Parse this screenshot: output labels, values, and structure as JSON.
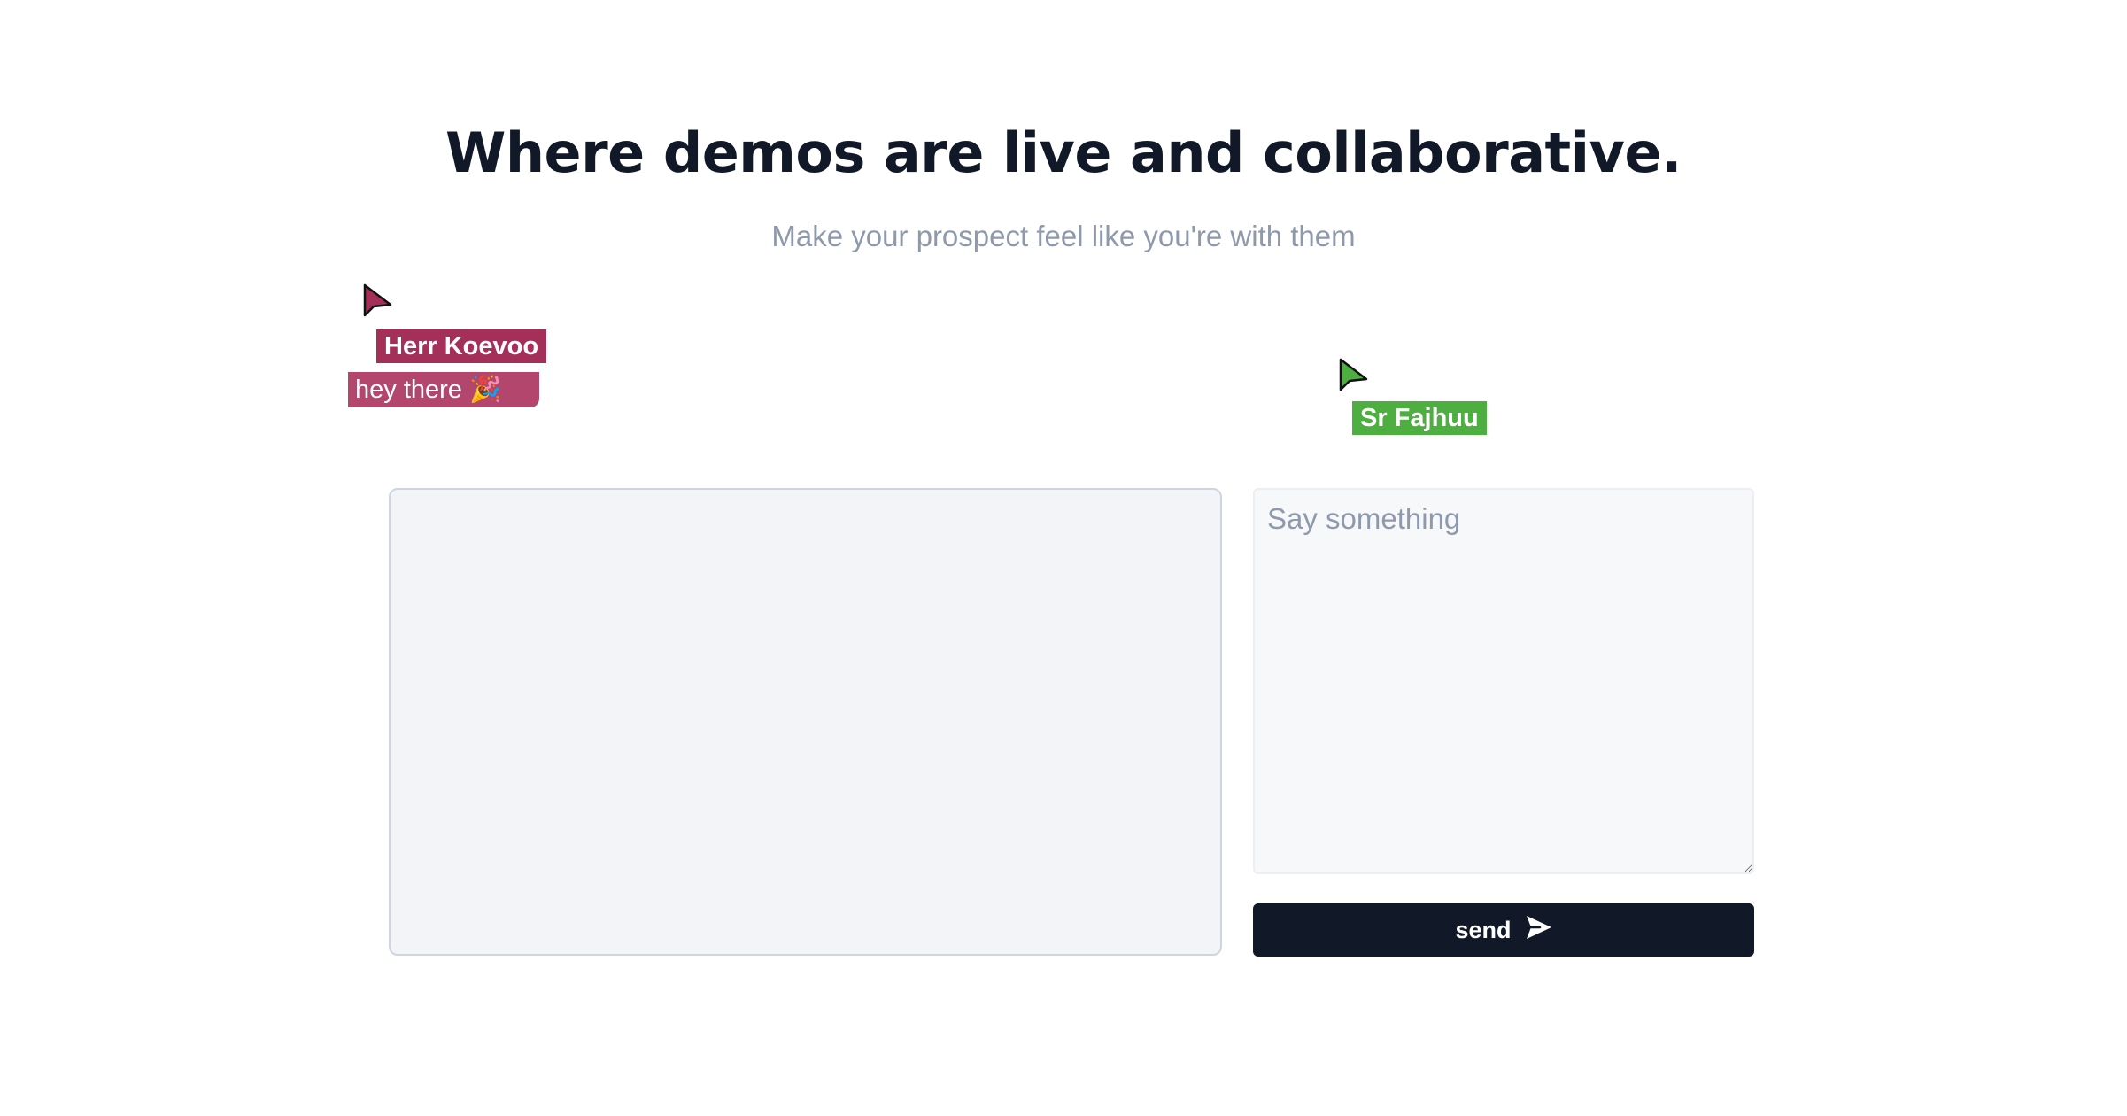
{
  "hero": {
    "title": "Where demos are live and collaborative.",
    "subtitle": "Make your prospect feel like you're with them"
  },
  "cursors": [
    {
      "name": "Herr Koevoo",
      "message": "hey there 🎉",
      "color": "#a4305a"
    },
    {
      "name": "Sr Fajhuu",
      "message": "",
      "color": "#4caf3f"
    }
  ],
  "chat": {
    "placeholder": "Say something",
    "send_label": "send",
    "send_icon": "paper-plane-icon"
  },
  "colors": {
    "heading": "#111827",
    "subtitle": "#8e99ac",
    "button": "#111827",
    "stage_bg": "#f2f4f8"
  }
}
